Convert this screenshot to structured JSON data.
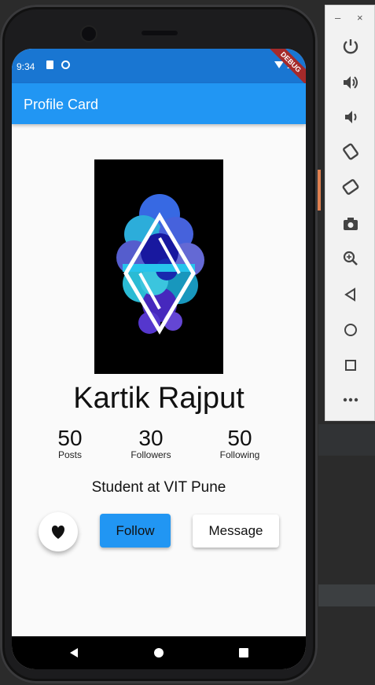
{
  "status_bar": {
    "time": "9:34",
    "debug_banner": "DEBUG"
  },
  "app_bar": {
    "title": "Profile Card"
  },
  "profile": {
    "name": "Kartik Rajput",
    "bio": "Student at VIT Pune",
    "stats": [
      {
        "value": "50",
        "label": "Posts"
      },
      {
        "value": "30",
        "label": "Followers"
      },
      {
        "value": "50",
        "label": "Following"
      }
    ]
  },
  "actions": {
    "like_icon": "heart-icon",
    "follow_label": "Follow",
    "message_label": "Message"
  },
  "emulator_panel": {
    "minimize": "–",
    "close": "×",
    "tools": [
      "power-icon",
      "volume-up-icon",
      "volume-down-icon",
      "rotate-left-icon",
      "rotate-right-icon",
      "camera-icon",
      "zoom-icon",
      "back-icon",
      "home-icon",
      "overview-icon",
      "more-icon"
    ]
  },
  "colors": {
    "primary": "#2196f3",
    "status_bar": "#1976d2",
    "screen_bg": "#fafafa"
  }
}
